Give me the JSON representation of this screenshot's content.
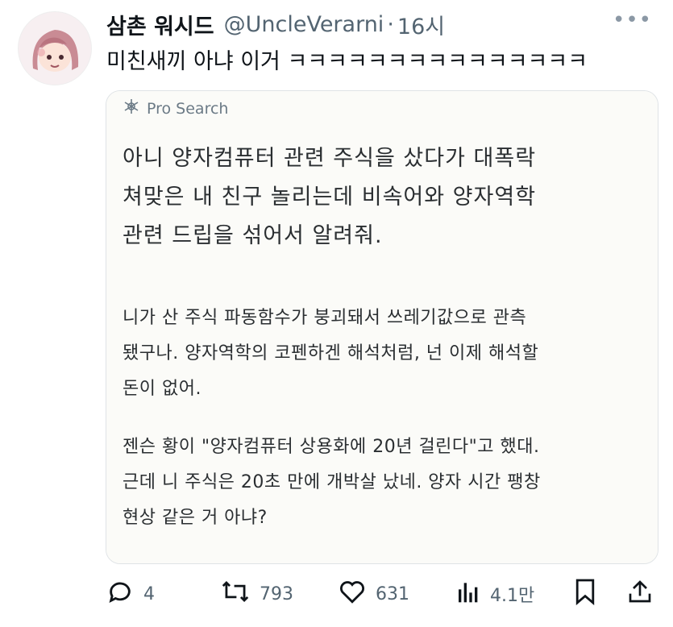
{
  "tweet": {
    "display_name": "삼촌 워시드",
    "handle": "@UncleVerarni",
    "separator": "·",
    "time": "16시",
    "more_label": "•••",
    "text": "미친새끼 아냐 이거 ㅋㅋㅋㅋㅋㅋㅋㅋㅋㅋㅋㅋㅋㅋㅋ"
  },
  "card": {
    "source_label": "Pro Search",
    "question": [
      "아니 양자컴퓨터 관련 주식을 샀다가 대폭락",
      "쳐맞은 내 친구 놀리는데 비속어와 양자역학",
      "관련 드립을 섞어서 알려줘."
    ],
    "answer_paragraph_1": [
      "니가 산 주식 파동함수가 붕괴돼서 쓰레기값으로 관측",
      "됐구나. 양자역학의 코펜하겐 해석처럼, 넌 이제 해석할",
      "돈이 없어."
    ],
    "answer_paragraph_2": [
      "젠슨 황이 \"양자컴퓨터 상용화에 20년 걸린다\"고 했대.",
      "근데 니 주식은 20초 만에 개박살 났네. 양자 시간 팽창",
      "현상 같은 거 아냐?"
    ]
  },
  "actions": {
    "replies": "4",
    "retweets": "793",
    "likes": "631",
    "views": "4.1만"
  },
  "icons": {
    "reply": "reply-icon",
    "retweet": "retweet-icon",
    "like": "heart-icon",
    "views": "views-icon",
    "bookmark": "bookmark-icon",
    "share": "share-icon",
    "pro_search": "pro-search-icon"
  },
  "colors": {
    "text_primary": "#0f1419",
    "text_secondary": "#536471"
  }
}
